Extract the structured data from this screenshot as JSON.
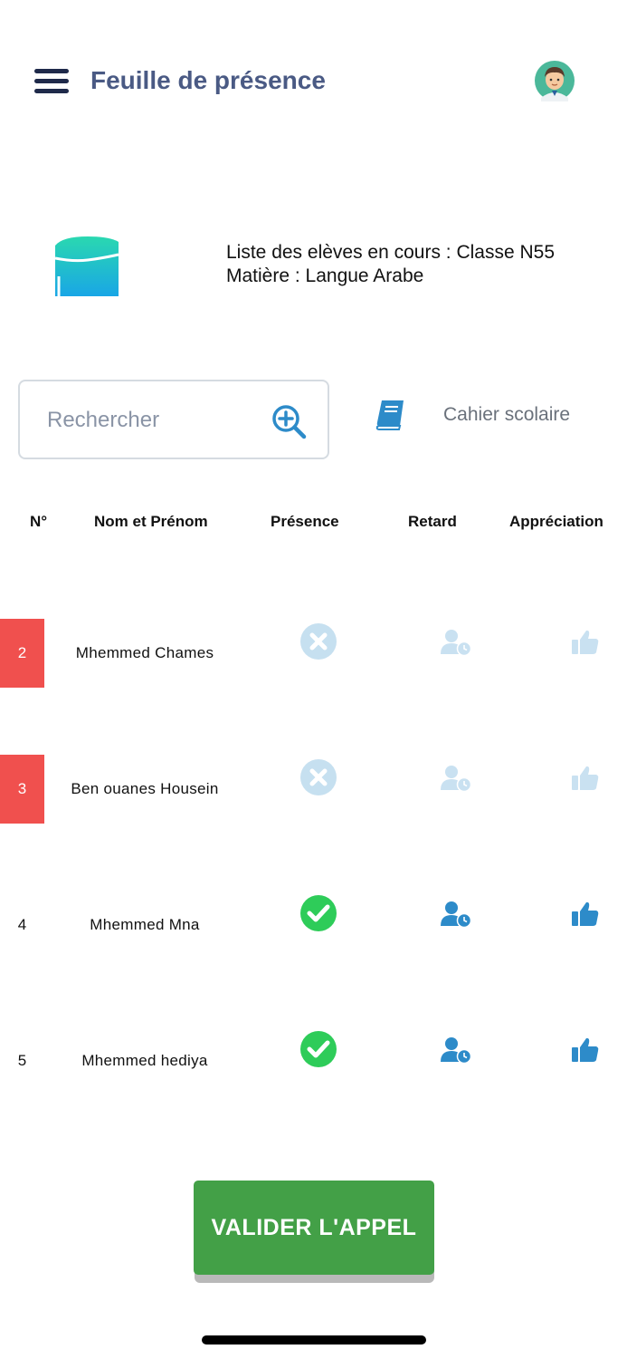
{
  "header": {
    "title": "Feuille de présence",
    "menu_icon": "hamburger-menu-icon",
    "avatar_icon": "user-avatar"
  },
  "class_info": {
    "line1": "Liste des elèves en cours : Classe N55",
    "line2": "Matière : Langue Arabe",
    "logo_icon": "graduation-cap-icon"
  },
  "search": {
    "placeholder": "Rechercher",
    "value": "",
    "icon": "zoom-plus-icon"
  },
  "notebook": {
    "label": "Cahier scolaire",
    "icon": "book-icon"
  },
  "table": {
    "headers": {
      "num": "N°",
      "name": "Nom et Prénom",
      "presence": "Présence",
      "retard": "Retard",
      "appreciation": "Appréciation"
    },
    "rows": [
      {
        "num": "2",
        "name": "Mhemmed Chames",
        "status": "absent"
      },
      {
        "num": "3",
        "name": "Ben ouanes Housein",
        "status": "absent"
      },
      {
        "num": "4",
        "name": "Mhemmed Mna",
        "status": "present"
      },
      {
        "num": "5",
        "name": "Mhemmed hediya",
        "status": "present"
      }
    ]
  },
  "validate_button": {
    "label": "VALIDER L'APPEL"
  },
  "colors": {
    "title": "#4a5a84",
    "absent_badge": "#f0504e",
    "present_check": "#2ecc59",
    "absent_x": "#c6e0f0",
    "icon_active": "#2d8bc9",
    "icon_inactive": "#c9e1f1",
    "validate_button": "#43a047"
  }
}
